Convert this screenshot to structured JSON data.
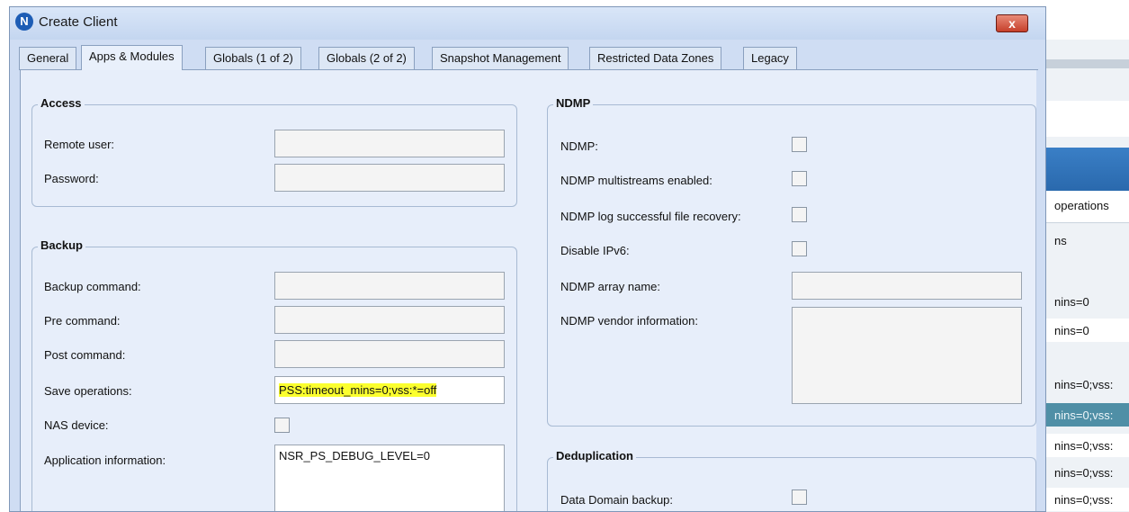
{
  "dialog": {
    "title": "Create Client",
    "close_label": "x",
    "icon_letter": "N"
  },
  "tabs": [
    {
      "label": "General"
    },
    {
      "label": "Apps & Modules"
    },
    {
      "label": "Globals (1 of 2)"
    },
    {
      "label": "Globals (2 of 2)"
    },
    {
      "label": "Snapshot Management"
    },
    {
      "label": "Restricted Data Zones"
    },
    {
      "label": "Legacy"
    }
  ],
  "access": {
    "title": "Access",
    "remote_user_label": "Remote user:",
    "remote_user_value": "",
    "password_label": "Password:",
    "password_value": ""
  },
  "backup": {
    "title": "Backup",
    "backup_command_label": "Backup command:",
    "backup_command_value": "",
    "pre_command_label": "Pre command:",
    "pre_command_value": "",
    "post_command_label": "Post command:",
    "post_command_value": "",
    "save_operations_label": "Save operations:",
    "save_operations_value": "PSS:timeout_mins=0;vss:*=off",
    "nas_device_label": "NAS device:",
    "application_information_label": "Application information:",
    "application_information_value": "NSR_PS_DEBUG_LEVEL=0"
  },
  "ndmp": {
    "title": "NDMP",
    "ndmp_label": "NDMP:",
    "multistreams_label": "NDMP multistreams enabled:",
    "log_recovery_label": "NDMP log successful file recovery:",
    "disable_ipv6_label": "Disable IPv6:",
    "array_name_label": "NDMP array name:",
    "array_name_value": "",
    "vendor_info_label": "NDMP vendor information:",
    "vendor_info_value": ""
  },
  "dedup": {
    "title": "Deduplication",
    "data_domain_label": "Data Domain backup:"
  },
  "background_window": {
    "operations_label": "operations",
    "ns_label": "ns",
    "rows": [
      "nins=0",
      "nins=0",
      "nins=0;vss:",
      "nins=0;vss:",
      "nins=0;vss:",
      "nins=0;vss:",
      "nins=0;vss:"
    ]
  },
  "colors": {
    "highlight": "#fbff2e",
    "dialog_bg": "#cfddf3",
    "close_button": "#c6402b",
    "selected_row": "#4f8fa6"
  }
}
